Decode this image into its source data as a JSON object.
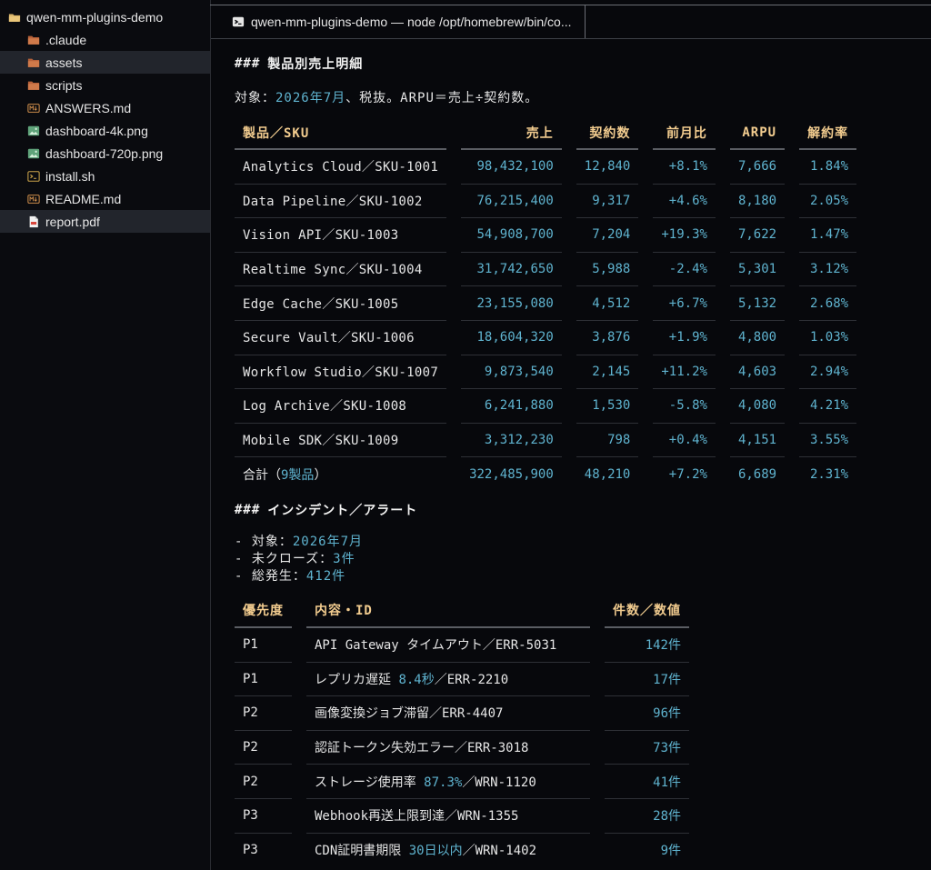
{
  "sidebar": {
    "root": "qwen-mm-plugins-demo",
    "items": [
      {
        "label": ".claude",
        "icon": "folder-icon",
        "selected": false
      },
      {
        "label": "assets",
        "icon": "folder-icon",
        "selected": true
      },
      {
        "label": "scripts",
        "icon": "folder-icon",
        "selected": false
      },
      {
        "label": "ANSWERS.md",
        "icon": "markdown-file-icon",
        "selected": false
      },
      {
        "label": "dashboard-4k.png",
        "icon": "image-file-icon",
        "selected": false
      },
      {
        "label": "dashboard-720p.png",
        "icon": "image-file-icon",
        "selected": false
      },
      {
        "label": "install.sh",
        "icon": "terminal-file-icon",
        "selected": false
      },
      {
        "label": "README.md",
        "icon": "markdown-file-icon",
        "selected": false
      },
      {
        "label": "report.pdf",
        "icon": "pdf-file-icon",
        "selected": true
      }
    ]
  },
  "tab": {
    "title": "qwen-mm-plugins-demo — node /opt/homebrew/bin/co..."
  },
  "section1": {
    "hash": "###",
    "title": "製品別売上明細",
    "summary_prefix": "対象：",
    "summary_value": "2026年7月",
    "summary_suffix": "、税抜。ARPU＝売上÷契約数。",
    "columns": [
      "製品／SKU",
      "売上",
      "契約数",
      "前月比",
      "ARPU",
      "解約率"
    ],
    "rows": [
      [
        "Analytics Cloud／SKU-1001",
        "98,432,100",
        "12,840",
        "+8.1%",
        "7,666",
        "1.84%"
      ],
      [
        "Data Pipeline／SKU-1002",
        "76,215,400",
        "9,317",
        "+4.6%",
        "8,180",
        "2.05%"
      ],
      [
        "Vision API／SKU-1003",
        "54,908,700",
        "7,204",
        "+19.3%",
        "7,622",
        "1.47%"
      ],
      [
        "Realtime Sync／SKU-1004",
        "31,742,650",
        "5,988",
        "-2.4%",
        "5,301",
        "3.12%"
      ],
      [
        "Edge Cache／SKU-1005",
        "23,155,080",
        "4,512",
        "+6.7%",
        "5,132",
        "2.68%"
      ],
      [
        "Secure Vault／SKU-1006",
        "18,604,320",
        "3,876",
        "+1.9%",
        "4,800",
        "1.03%"
      ],
      [
        "Workflow Studio／SKU-1007",
        "9,873,540",
        "2,145",
        "+11.2%",
        "4,603",
        "2.94%"
      ],
      [
        "Log Archive／SKU-1008",
        "6,241,880",
        "1,530",
        "-5.8%",
        "4,080",
        "4.21%"
      ],
      [
        "Mobile SDK／SKU-1009",
        "3,312,230",
        "798",
        "+0.4%",
        "4,151",
        "3.55%"
      ]
    ],
    "total": {
      "label_prefix": "合計（",
      "label_value": "9製品",
      "label_suffix": "）",
      "values": [
        "322,485,900",
        "48,210",
        "+7.2%",
        "6,689",
        "2.31%"
      ]
    }
  },
  "section2": {
    "hash": "###",
    "title": "インシデント／アラート",
    "bullets": [
      {
        "key": "- 対象：",
        "value": "2026年7月"
      },
      {
        "key": "- 未クローズ：",
        "value": "3件"
      },
      {
        "key": "- 総発生：",
        "value": "412件"
      }
    ],
    "columns": [
      "優先度",
      "内容・ID",
      "件数／数値"
    ],
    "rows": [
      {
        "priority": "P1",
        "pre": "API Gateway タイムアウト",
        "hl": "",
        "post": "／ERR-5031",
        "count": "142件"
      },
      {
        "priority": "P1",
        "pre": "レプリカ遅延 ",
        "hl": "8.4秒",
        "post": "／ERR-2210",
        "count": "17件"
      },
      {
        "priority": "P2",
        "pre": "画像変換ジョブ滞留",
        "hl": "",
        "post": "／ERR-4407",
        "count": "96件"
      },
      {
        "priority": "P2",
        "pre": "認証トークン失効エラー",
        "hl": "",
        "post": "／ERR-3018",
        "count": "73件"
      },
      {
        "priority": "P2",
        "pre": "ストレージ使用率 ",
        "hl": "87.3%",
        "post": "／WRN-1120",
        "count": "41件"
      },
      {
        "priority": "P3",
        "pre": "Webhook再送上限到達",
        "hl": "",
        "post": "／WRN-1355",
        "count": "28件"
      },
      {
        "priority": "P3",
        "pre": "CDN証明書期限 ",
        "hl": "30日以内",
        "post": "／WRN-1402",
        "count": "9件"
      }
    ]
  },
  "colors": {
    "accent": "#5fb3cf",
    "header": "#f2cc8f",
    "background": "#07080c"
  }
}
